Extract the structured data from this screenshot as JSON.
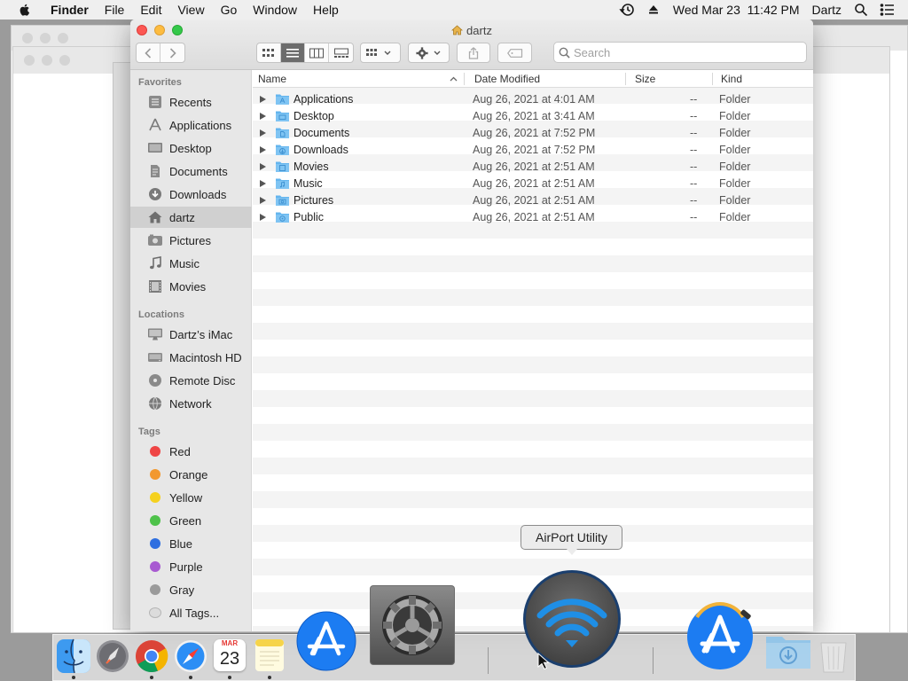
{
  "menubar": {
    "app": "Finder",
    "items": [
      "File",
      "Edit",
      "View",
      "Go",
      "Window",
      "Help"
    ],
    "datetime": "Wed Mar 23  11:42 PM",
    "user": "Dartz"
  },
  "window": {
    "title": "dartz",
    "search_placeholder": "Search"
  },
  "sidebar": {
    "favorites_label": "Favorites",
    "favorites": [
      {
        "label": "Recents",
        "icon": "recents-icon"
      },
      {
        "label": "Applications",
        "icon": "applications-icon"
      },
      {
        "label": "Desktop",
        "icon": "desktop-icon"
      },
      {
        "label": "Documents",
        "icon": "documents-icon"
      },
      {
        "label": "Downloads",
        "icon": "downloads-icon"
      },
      {
        "label": "dartz",
        "icon": "home-icon",
        "selected": true
      },
      {
        "label": "Pictures",
        "icon": "pictures-icon"
      },
      {
        "label": "Music",
        "icon": "music-icon"
      },
      {
        "label": "Movies",
        "icon": "movies-icon"
      }
    ],
    "locations_label": "Locations",
    "locations": [
      {
        "label": "Dartz’s iMac",
        "icon": "imac-icon"
      },
      {
        "label": "Macintosh HD",
        "icon": "hard-disk-icon"
      },
      {
        "label": "Remote Disc",
        "icon": "disc-icon"
      },
      {
        "label": "Network",
        "icon": "network-icon"
      }
    ],
    "tags_label": "Tags",
    "tags": [
      {
        "label": "Red",
        "color": "#ef4545"
      },
      {
        "label": "Orange",
        "color": "#f2982e"
      },
      {
        "label": "Yellow",
        "color": "#f5d11f"
      },
      {
        "label": "Green",
        "color": "#4ec24a"
      },
      {
        "label": "Blue",
        "color": "#2f6fe0"
      },
      {
        "label": "Purple",
        "color": "#a85ad1"
      },
      {
        "label": "Gray",
        "color": "#9a9a9a"
      },
      {
        "label": "All Tags...",
        "color": "all"
      }
    ]
  },
  "columns": {
    "name": "Name",
    "date": "Date Modified",
    "size": "Size",
    "kind": "Kind"
  },
  "files": [
    {
      "name": "Applications",
      "date": "Aug 26, 2021 at 4:01 AM",
      "size": "--",
      "kind": "Folder"
    },
    {
      "name": "Desktop",
      "date": "Aug 26, 2021 at 3:41 AM",
      "size": "--",
      "kind": "Folder"
    },
    {
      "name": "Documents",
      "date": "Aug 26, 2021 at 7:52 PM",
      "size": "--",
      "kind": "Folder"
    },
    {
      "name": "Downloads",
      "date": "Aug 26, 2021 at 7:52 PM",
      "size": "--",
      "kind": "Folder"
    },
    {
      "name": "Movies",
      "date": "Aug 26, 2021 at 2:51 AM",
      "size": "--",
      "kind": "Folder"
    },
    {
      "name": "Music",
      "date": "Aug 26, 2021 at 2:51 AM",
      "size": "--",
      "kind": "Folder"
    },
    {
      "name": "Pictures",
      "date": "Aug 26, 2021 at 2:51 AM",
      "size": "--",
      "kind": "Folder"
    },
    {
      "name": "Public",
      "date": "Aug 26, 2021 at 2:51 AM",
      "size": "--",
      "kind": "Folder"
    }
  ],
  "dock": {
    "tooltip": "AirPort Utility",
    "calendar_month": "MAR",
    "calendar_day": "23"
  },
  "colors": {
    "accent": "#2a8ff0",
    "folder": "#64b5ee",
    "close": "#fc5753",
    "minimize": "#fdbc40",
    "zoom": "#34c84a"
  }
}
